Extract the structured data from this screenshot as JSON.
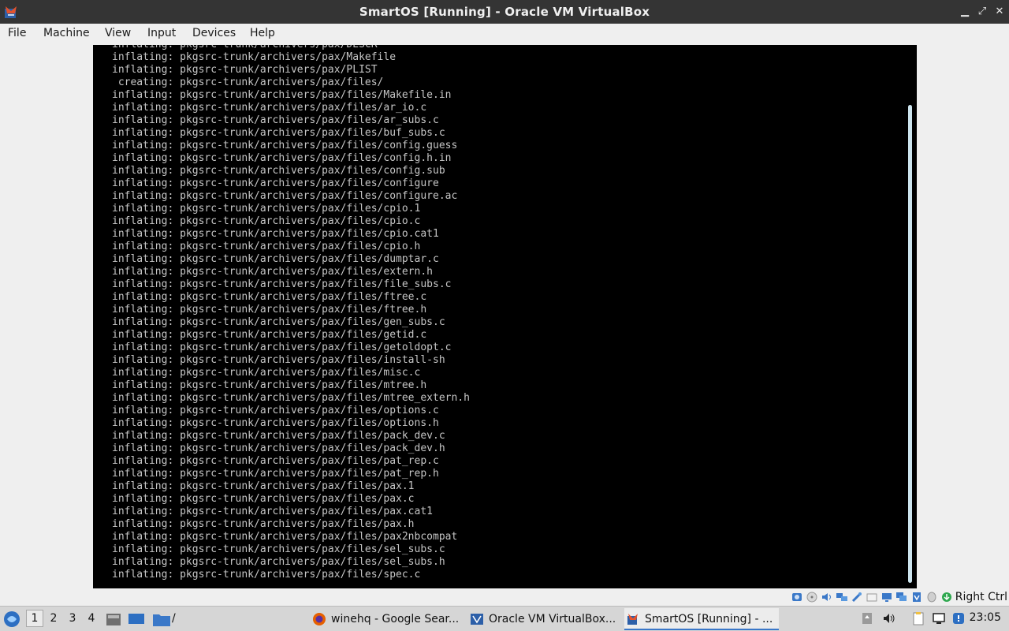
{
  "window": {
    "title": "SmartOS [Running] - Oracle VM VirtualBox",
    "minimize_glyph": "▁",
    "maximize_glyph": "⤢",
    "close_glyph": "✕"
  },
  "menu": [
    "File",
    "Machine",
    "View",
    "Input",
    "Devices",
    "Help"
  ],
  "console_lines": [
    "inflating: pkgsrc-trunk/archivers/pax/DESCR",
    "inflating: pkgsrc-trunk/archivers/pax/Makefile",
    "inflating: pkgsrc-trunk/archivers/pax/PLIST",
    " creating: pkgsrc-trunk/archivers/pax/files/",
    "inflating: pkgsrc-trunk/archivers/pax/files/Makefile.in",
    "inflating: pkgsrc-trunk/archivers/pax/files/ar_io.c",
    "inflating: pkgsrc-trunk/archivers/pax/files/ar_subs.c",
    "inflating: pkgsrc-trunk/archivers/pax/files/buf_subs.c",
    "inflating: pkgsrc-trunk/archivers/pax/files/config.guess",
    "inflating: pkgsrc-trunk/archivers/pax/files/config.h.in",
    "inflating: pkgsrc-trunk/archivers/pax/files/config.sub",
    "inflating: pkgsrc-trunk/archivers/pax/files/configure",
    "inflating: pkgsrc-trunk/archivers/pax/files/configure.ac",
    "inflating: pkgsrc-trunk/archivers/pax/files/cpio.1",
    "inflating: pkgsrc-trunk/archivers/pax/files/cpio.c",
    "inflating: pkgsrc-trunk/archivers/pax/files/cpio.cat1",
    "inflating: pkgsrc-trunk/archivers/pax/files/cpio.h",
    "inflating: pkgsrc-trunk/archivers/pax/files/dumptar.c",
    "inflating: pkgsrc-trunk/archivers/pax/files/extern.h",
    "inflating: pkgsrc-trunk/archivers/pax/files/file_subs.c",
    "inflating: pkgsrc-trunk/archivers/pax/files/ftree.c",
    "inflating: pkgsrc-trunk/archivers/pax/files/ftree.h",
    "inflating: pkgsrc-trunk/archivers/pax/files/gen_subs.c",
    "inflating: pkgsrc-trunk/archivers/pax/files/getid.c",
    "inflating: pkgsrc-trunk/archivers/pax/files/getoldopt.c",
    "inflating: pkgsrc-trunk/archivers/pax/files/install-sh",
    "inflating: pkgsrc-trunk/archivers/pax/files/misc.c",
    "inflating: pkgsrc-trunk/archivers/pax/files/mtree.h",
    "inflating: pkgsrc-trunk/archivers/pax/files/mtree_extern.h",
    "inflating: pkgsrc-trunk/archivers/pax/files/options.c",
    "inflating: pkgsrc-trunk/archivers/pax/files/options.h",
    "inflating: pkgsrc-trunk/archivers/pax/files/pack_dev.c",
    "inflating: pkgsrc-trunk/archivers/pax/files/pack_dev.h",
    "inflating: pkgsrc-trunk/archivers/pax/files/pat_rep.c",
    "inflating: pkgsrc-trunk/archivers/pax/files/pat_rep.h",
    "inflating: pkgsrc-trunk/archivers/pax/files/pax.1",
    "inflating: pkgsrc-trunk/archivers/pax/files/pax.c",
    "inflating: pkgsrc-trunk/archivers/pax/files/pax.cat1",
    "inflating: pkgsrc-trunk/archivers/pax/files/pax.h",
    "inflating: pkgsrc-trunk/archivers/pax/files/pax2nbcompat",
    "inflating: pkgsrc-trunk/archivers/pax/files/sel_subs.c",
    "inflating: pkgsrc-trunk/archivers/pax/files/sel_subs.h",
    "inflating: pkgsrc-trunk/archivers/pax/files/spec.c"
  ],
  "statusbar": {
    "icons": [
      "hard-disk-icon",
      "optical-drive-icon",
      "audio-icon",
      "network-icon",
      "usb-icon",
      "shared-folders-icon",
      "display-icon",
      "recording-icon",
      "virtualization-icon",
      "mouse-integration-icon",
      "keyboard-capture-icon"
    ],
    "host_key": "Right Ctrl"
  },
  "taskbar": {
    "workspaces": [
      "1",
      "2",
      "3",
      "4"
    ],
    "active_workspace": "1",
    "path_label": "/",
    "tasks": [
      {
        "label": "winehq - Google Sear...",
        "icon": "firefox-icon",
        "active": false
      },
      {
        "label": "Oracle VM VirtualBox...",
        "icon": "virtualbox-manager-icon",
        "active": false
      },
      {
        "label": "SmartOS [Running] - ...",
        "icon": "virtualbox-vm-icon",
        "active": true
      }
    ],
    "clock": "23:05"
  },
  "colors": {
    "titlebar_bg": "#343434",
    "console_bg": "#000000",
    "console_fg": "#c6c6c6",
    "accent": "#3a77c8"
  }
}
